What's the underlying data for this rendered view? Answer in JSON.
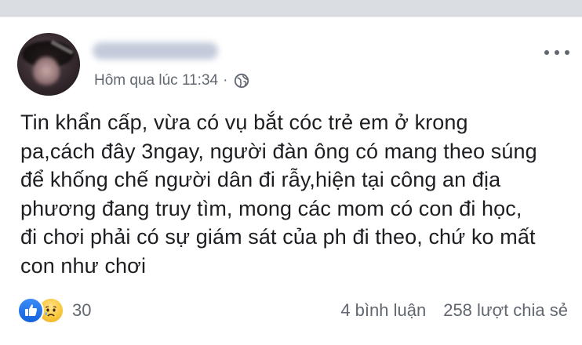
{
  "post": {
    "author_name": "Name hidden",
    "timestamp": "Hôm qua lúc 11:34",
    "separator": "·",
    "privacy_icon": "globe-icon",
    "more_icon": "more-horizontal-icon",
    "body_lines": [
      "Tin khẩn cấp, vừa có vụ bắt cóc trẻ em ở krong",
      "pa,cách đây 3ngay, người đàn ông có mang theo súng",
      "để khống chế người dân đi rẫy,hiện tại công an địa",
      "phương đang truy tìm, mong các mom có con đi học,",
      "đi chơi phải có sự giám sát của ph đi theo, chứ ko mất",
      "con như chơi"
    ],
    "reactions": {
      "icons": [
        "like-icon",
        "sad-icon"
      ],
      "count": "30"
    },
    "comments_label": "4 bình luận",
    "shares_label": "258 lượt chia sẻ"
  },
  "colors": {
    "like_blue": "#1877f2",
    "meta_gray": "#616770",
    "text": "#1c1e21"
  }
}
